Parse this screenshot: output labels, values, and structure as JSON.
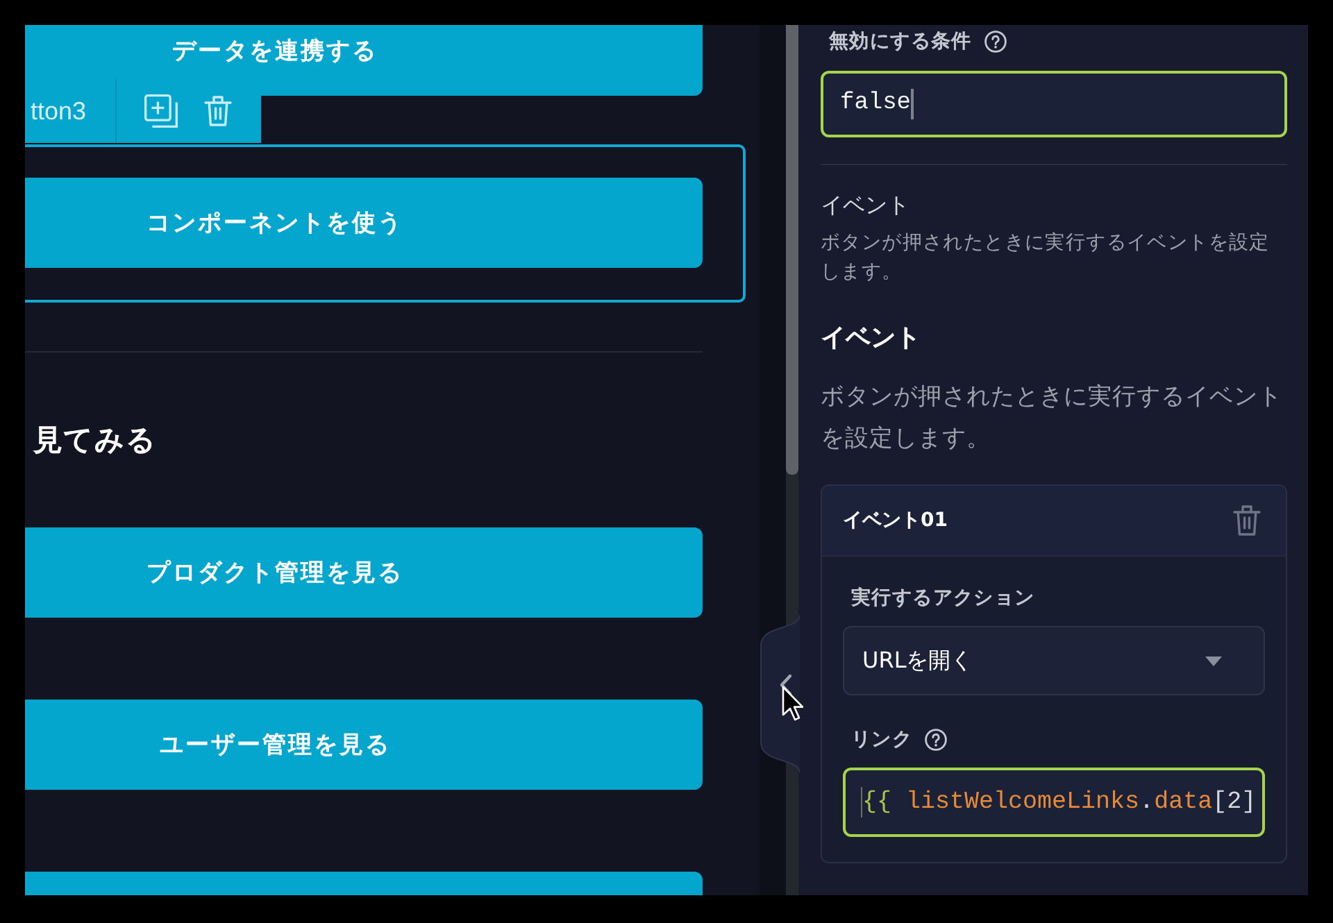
{
  "canvas": {
    "items": [
      {
        "kind": "button",
        "label": "データを連携する",
        "selected": false
      },
      {
        "kind": "button",
        "label": "コンポーネントを使う",
        "selected": true
      },
      {
        "kind": "section_heading",
        "text": "見てみる"
      },
      {
        "kind": "button",
        "label": "プロダクト管理を見る",
        "selected": false
      },
      {
        "kind": "button",
        "label": "ユーザー管理を見る",
        "selected": false
      },
      {
        "kind": "button",
        "selected": false
      }
    ],
    "selection_toolbar": {
      "component_name": "tton3"
    }
  },
  "properties_panel": {
    "disable_condition": {
      "label": "無効にする条件",
      "help": true,
      "value": "false",
      "focused": true,
      "caret": true,
      "caret_at_start": false
    },
    "event_section": {
      "title": "イベント",
      "description": "ボタンが押されたときに実行するイベントを設定します。"
    },
    "events": {
      "title": "イベント",
      "description": "ボタンが押されたときに実行するイベントを設定します。",
      "items": [
        {
          "title": "イベント01",
          "action": {
            "label": "実行するアクション",
            "value": "URLを開く"
          },
          "link": {
            "label": "リンク",
            "help": true,
            "focused": true,
            "caret": true,
            "caret_at_start": true,
            "tokens": [
              {
                "kind": "brace",
                "text": "{{ "
              },
              {
                "kind": "variable",
                "text": "listWelcomeLinks"
              },
              {
                "kind": "punctuation",
                "text": "."
              },
              {
                "kind": "variable",
                "text": "data"
              },
              {
                "kind": "punctuation",
                "text": "[2]"
              }
            ]
          }
        }
      ]
    }
  }
}
